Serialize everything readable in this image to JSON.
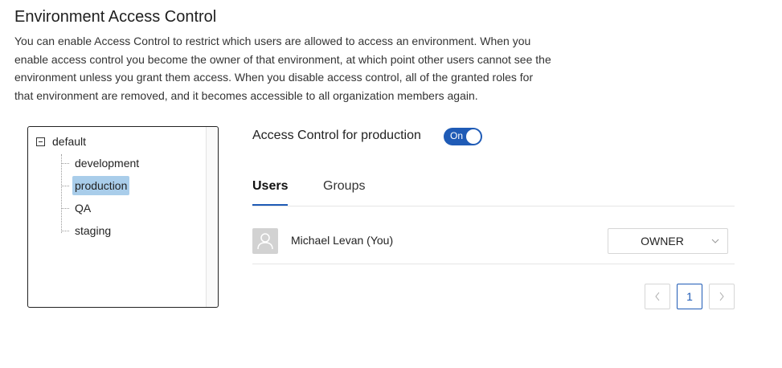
{
  "page": {
    "title": "Environment Access Control",
    "description_lines": [
      "You can enable Access Control to restrict which users are allowed to access an environment. When you",
      "enable access control you become the owner of that environment, at which point other users cannot see the",
      "environment unless you grant them access. When you disable access control, all of the granted roles for",
      "that environment are removed, and it becomes accessible to all organization members again."
    ]
  },
  "tree": {
    "root": "default",
    "children": [
      "development",
      "production",
      "QA",
      "staging"
    ],
    "selected": "production"
  },
  "access_control": {
    "label": "Access Control for production",
    "toggle_text": "On",
    "toggle_on": true,
    "accent_color": "#1f5bb6"
  },
  "tabs": [
    {
      "label": "Users",
      "active": true
    },
    {
      "label": "Groups",
      "active": false
    }
  ],
  "users": [
    {
      "name": "Michael Levan (You)",
      "role": "OWNER",
      "avatar_icon": "user-icon"
    }
  ],
  "pagination": {
    "current_page": "1",
    "prev_icon": "chevron-left-icon",
    "next_icon": "chevron-right-icon"
  }
}
